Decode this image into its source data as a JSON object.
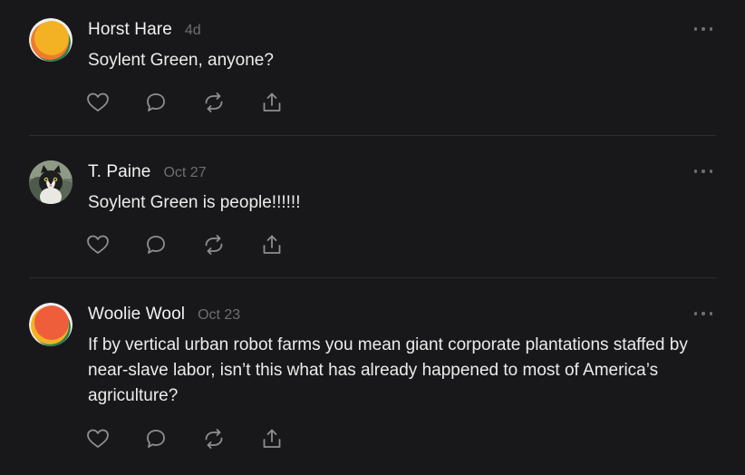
{
  "posts": [
    {
      "author": "Horst Hare",
      "time": "4d",
      "text": "Soylent Green, anyone?",
      "avatar": "orange-yellow-green-circle-avatar"
    },
    {
      "author": "T. Paine",
      "time": "Oct 27",
      "text": "Soylent Green is people!!!!!!",
      "avatar": "cat-photo-avatar"
    },
    {
      "author": "Woolie Wool",
      "time": "Oct 23",
      "text": "If by vertical urban robot farms you mean giant corporate plantations staffed by near-slave labor, isn’t this what has already happened to most of America’s agriculture?",
      "avatar": "orange-red-green-circle-avatar"
    }
  ],
  "action_icons": [
    "heart-icon",
    "comment-icon",
    "repost-icon",
    "share-icon"
  ],
  "colors": {
    "background": "#18181a",
    "text": "#ececec",
    "muted": "#6e6e73",
    "divider": "#2e2e31",
    "icon": "#8e8e93"
  }
}
